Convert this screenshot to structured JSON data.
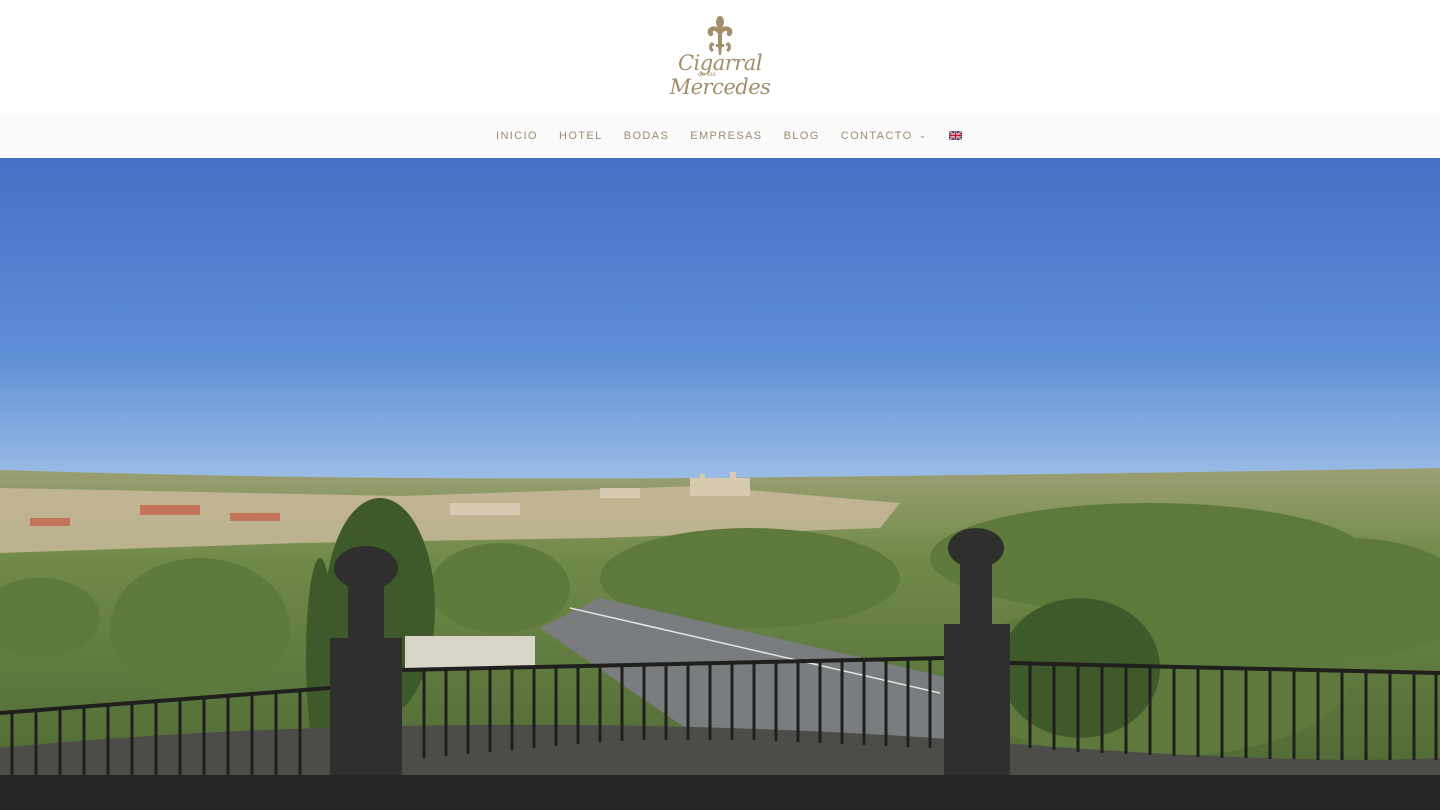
{
  "logo": {
    "line1": "Cigarral",
    "line2": "de las",
    "line3": "Mercedes"
  },
  "nav": {
    "items": [
      {
        "label": "INICIO"
      },
      {
        "label": "HOTEL"
      },
      {
        "label": "BODAS"
      },
      {
        "label": "EMPRESAS"
      },
      {
        "label": "BLOG"
      },
      {
        "label": "CONTACTO"
      }
    ],
    "dropdown_icon": "chevron-down-icon",
    "language_icon": "uk-flag-icon"
  },
  "colors": {
    "brand": "#a38e6c",
    "nav_text": "#9d8b6e",
    "sky": "#4a78c8",
    "footer": "#262626"
  }
}
